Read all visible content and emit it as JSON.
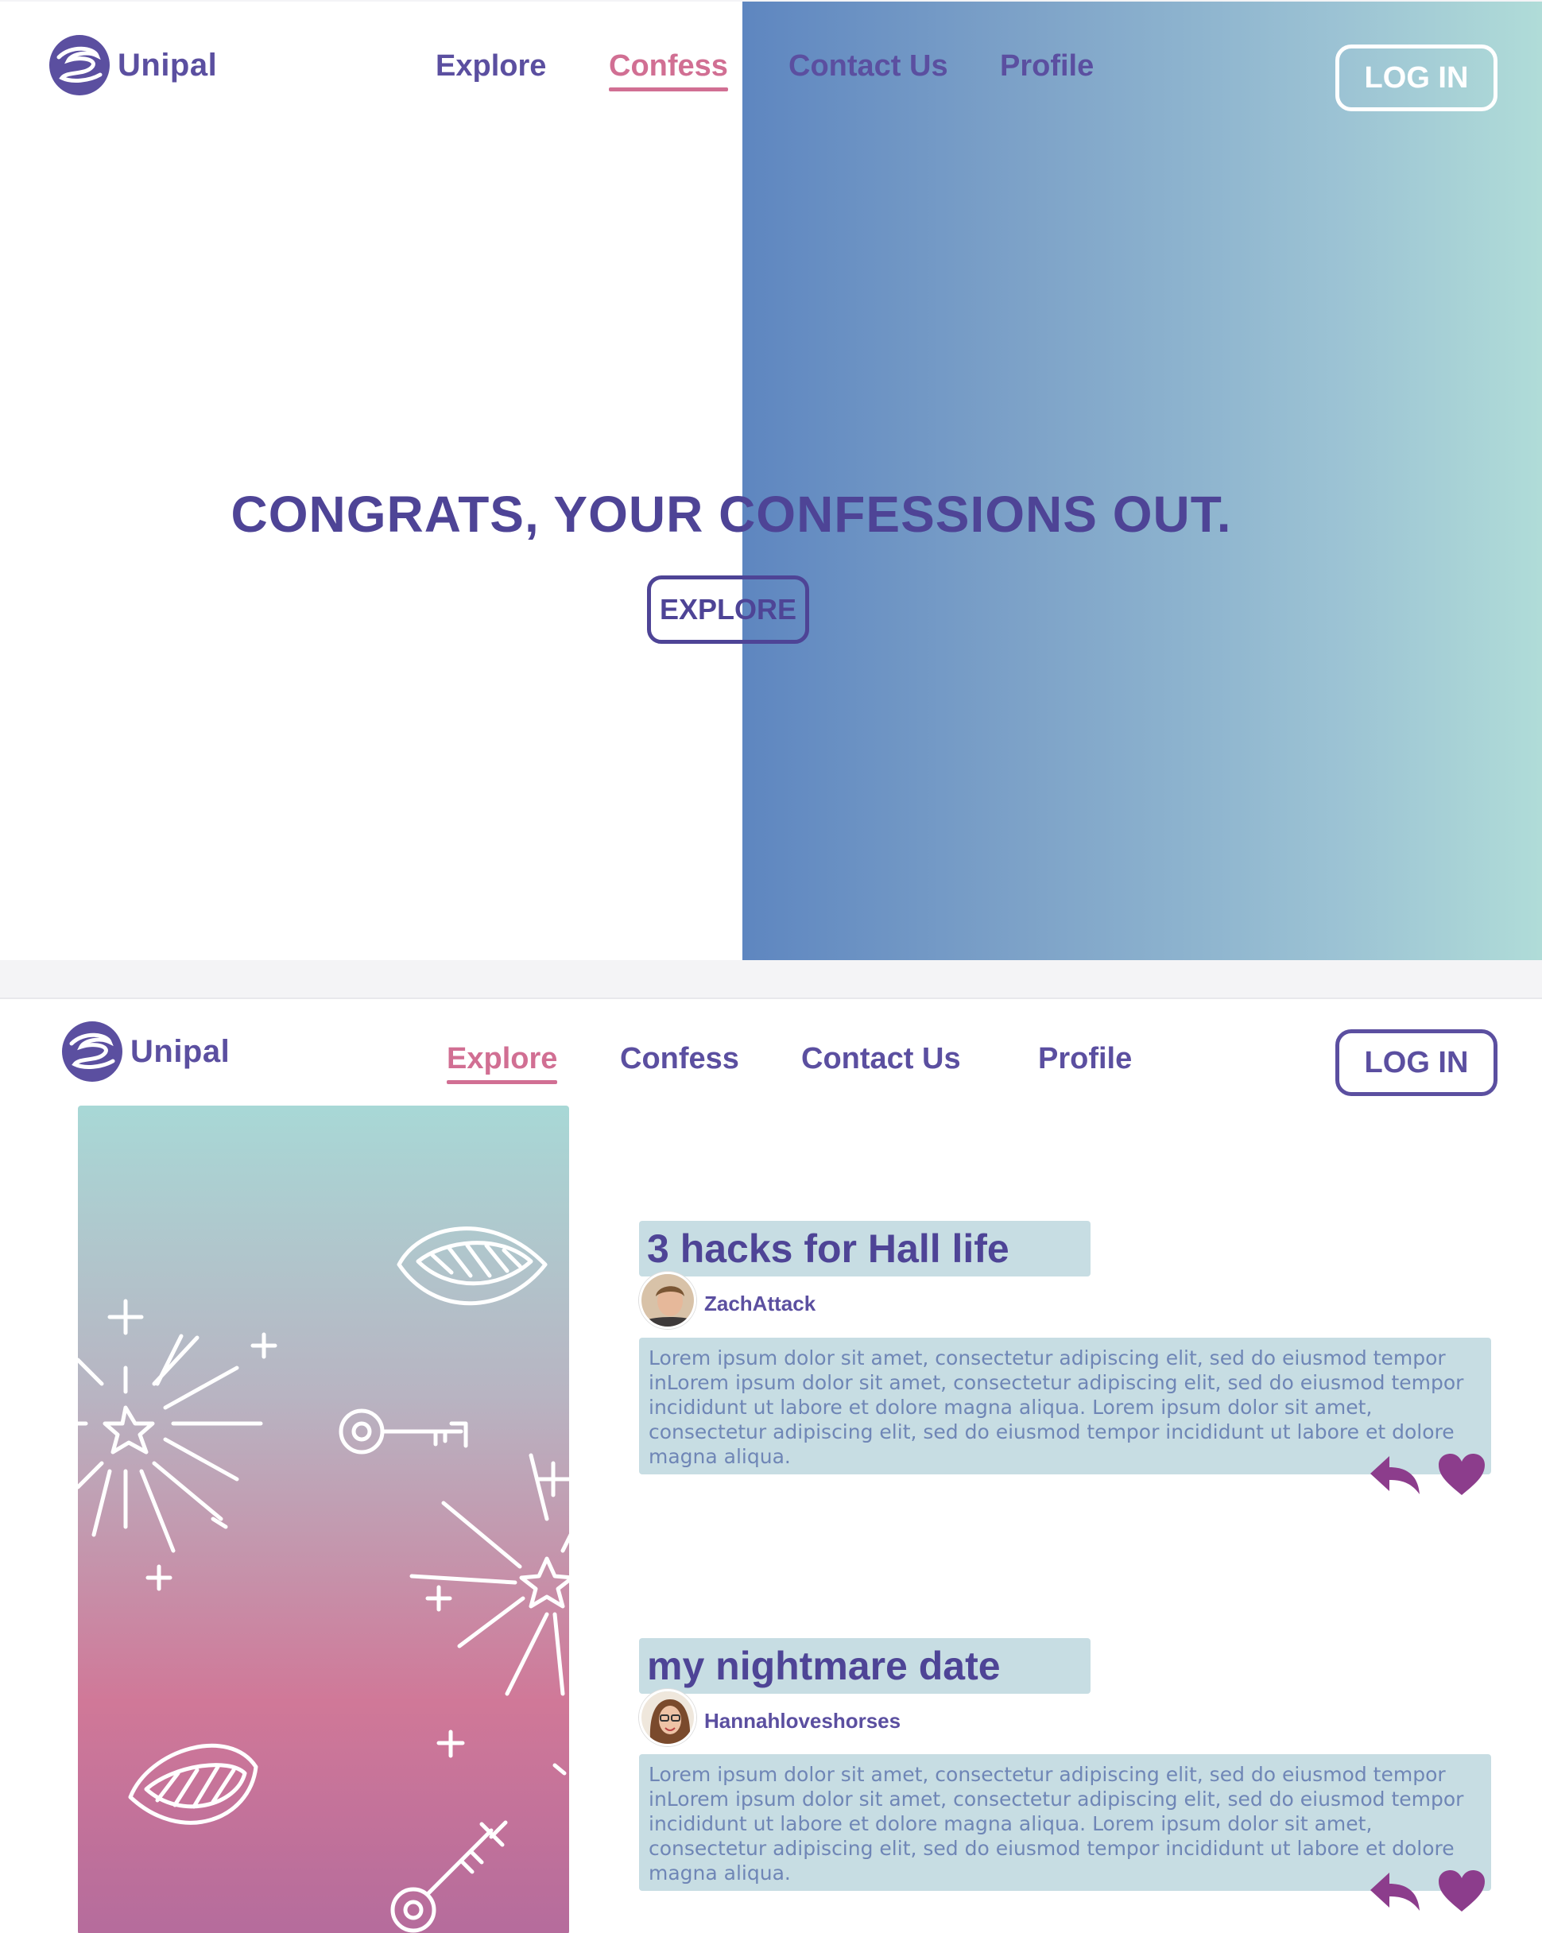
{
  "brand": {
    "name": "Unipal"
  },
  "screen1": {
    "nav": [
      {
        "label": "Explore",
        "active": false
      },
      {
        "label": "Confess",
        "active": true
      },
      {
        "label": "Contact Us",
        "active": false
      },
      {
        "label": "Profile",
        "active": false
      }
    ],
    "login_label": "LOG IN",
    "hero_title": "CONGRATS, YOUR CONFESSIONS  OUT.",
    "cta_label": "EXPLORE"
  },
  "screen2": {
    "nav": [
      {
        "label": "Explore",
        "active": true
      },
      {
        "label": "Confess",
        "active": false
      },
      {
        "label": "Contact Us",
        "active": false
      },
      {
        "label": "Profile",
        "active": false
      }
    ],
    "login_label": "LOG IN",
    "posts": [
      {
        "title": "3 hacks for Hall life",
        "author": "ZachAttack",
        "avatar_icon": "avatar-male",
        "body": "Lorem ipsum dolor sit amet, consectetur adipiscing elit, sed do eiusmod tempor inLorem ipsum dolor sit amet, consectetur adipiscing elit, sed do eiusmod tempor incididunt ut labore et dolore magna aliqua. Lorem ipsum dolor sit amet, consectetur adipiscing elit, sed do eiusmod tempor incididunt ut labore et dolore magna aliqua."
      },
      {
        "title": "my nightmare date",
        "author": "Hannahloveshorses",
        "avatar_icon": "avatar-female",
        "body": "Lorem ipsum dolor sit amet, consectetur adipiscing elit, sed do eiusmod tempor inLorem ipsum dolor sit amet, consectetur adipiscing elit, sed do eiusmod tempor incididunt ut labore et dolore magna aliqua. Lorem ipsum dolor sit amet, consectetur adipiscing elit, sed do eiusmod tempor incididunt ut labore et dolore magna aliqua."
      }
    ]
  },
  "colors": {
    "brand_purple": "#5b4fa0",
    "accent_pink": "#d16f93",
    "card_bg": "#c7dde3",
    "action_magenta": "#8c3d8c"
  },
  "icons": [
    "logo-icon",
    "reply-icon",
    "heart-icon",
    "lips-icon",
    "key-icon",
    "sparkle-icon"
  ]
}
